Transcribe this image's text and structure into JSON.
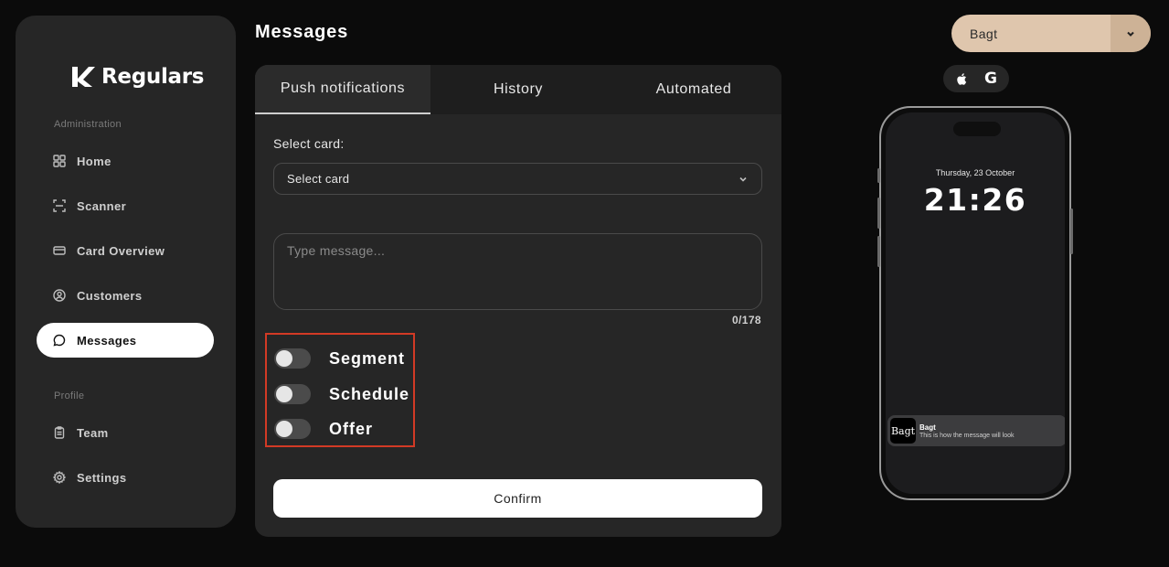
{
  "app": {
    "logo_text": "Regulars"
  },
  "sidebar": {
    "admin_label": "Administration",
    "profile_label": "Profile",
    "items": [
      {
        "label": "Home",
        "icon": "grid-icon"
      },
      {
        "label": "Scanner",
        "icon": "scan-icon"
      },
      {
        "label": "Card Overview",
        "icon": "card-icon"
      },
      {
        "label": "Customers",
        "icon": "user-circle-icon"
      },
      {
        "label": "Messages",
        "icon": "chat-bubble-icon",
        "active": true
      },
      {
        "label": "Team",
        "icon": "clipboard-icon"
      },
      {
        "label": "Settings",
        "icon": "gear-icon"
      }
    ]
  },
  "page": {
    "title": "Messages"
  },
  "tabs": [
    {
      "label": "Push notifications",
      "active": true
    },
    {
      "label": "History",
      "active": false
    },
    {
      "label": "Automated",
      "active": false
    }
  ],
  "form": {
    "select_card_label": "Select card:",
    "select_card_value": "Select card",
    "message_placeholder": "Type message...",
    "message_value": "",
    "char_count": "0/178",
    "toggles": [
      {
        "label": "Segment",
        "on": false
      },
      {
        "label": "Schedule",
        "on": false
      },
      {
        "label": "Offer",
        "on": false
      }
    ],
    "confirm_label": "Confirm"
  },
  "brand_selector": {
    "value": "Bagt"
  },
  "platforms": [
    {
      "name": "apple-icon"
    },
    {
      "name": "google-icon",
      "glyph": "G"
    }
  ],
  "preview": {
    "date": "Thursday, 23 October",
    "time": "21:26",
    "notification": {
      "logo_text": "Bagt",
      "title": "Bagt",
      "body": "This is how the message will look"
    }
  },
  "colors": {
    "background": "#0b0b0b",
    "panel": "#262626",
    "accent_brand": "#dfc6ad",
    "highlight_border": "#d23a25"
  }
}
